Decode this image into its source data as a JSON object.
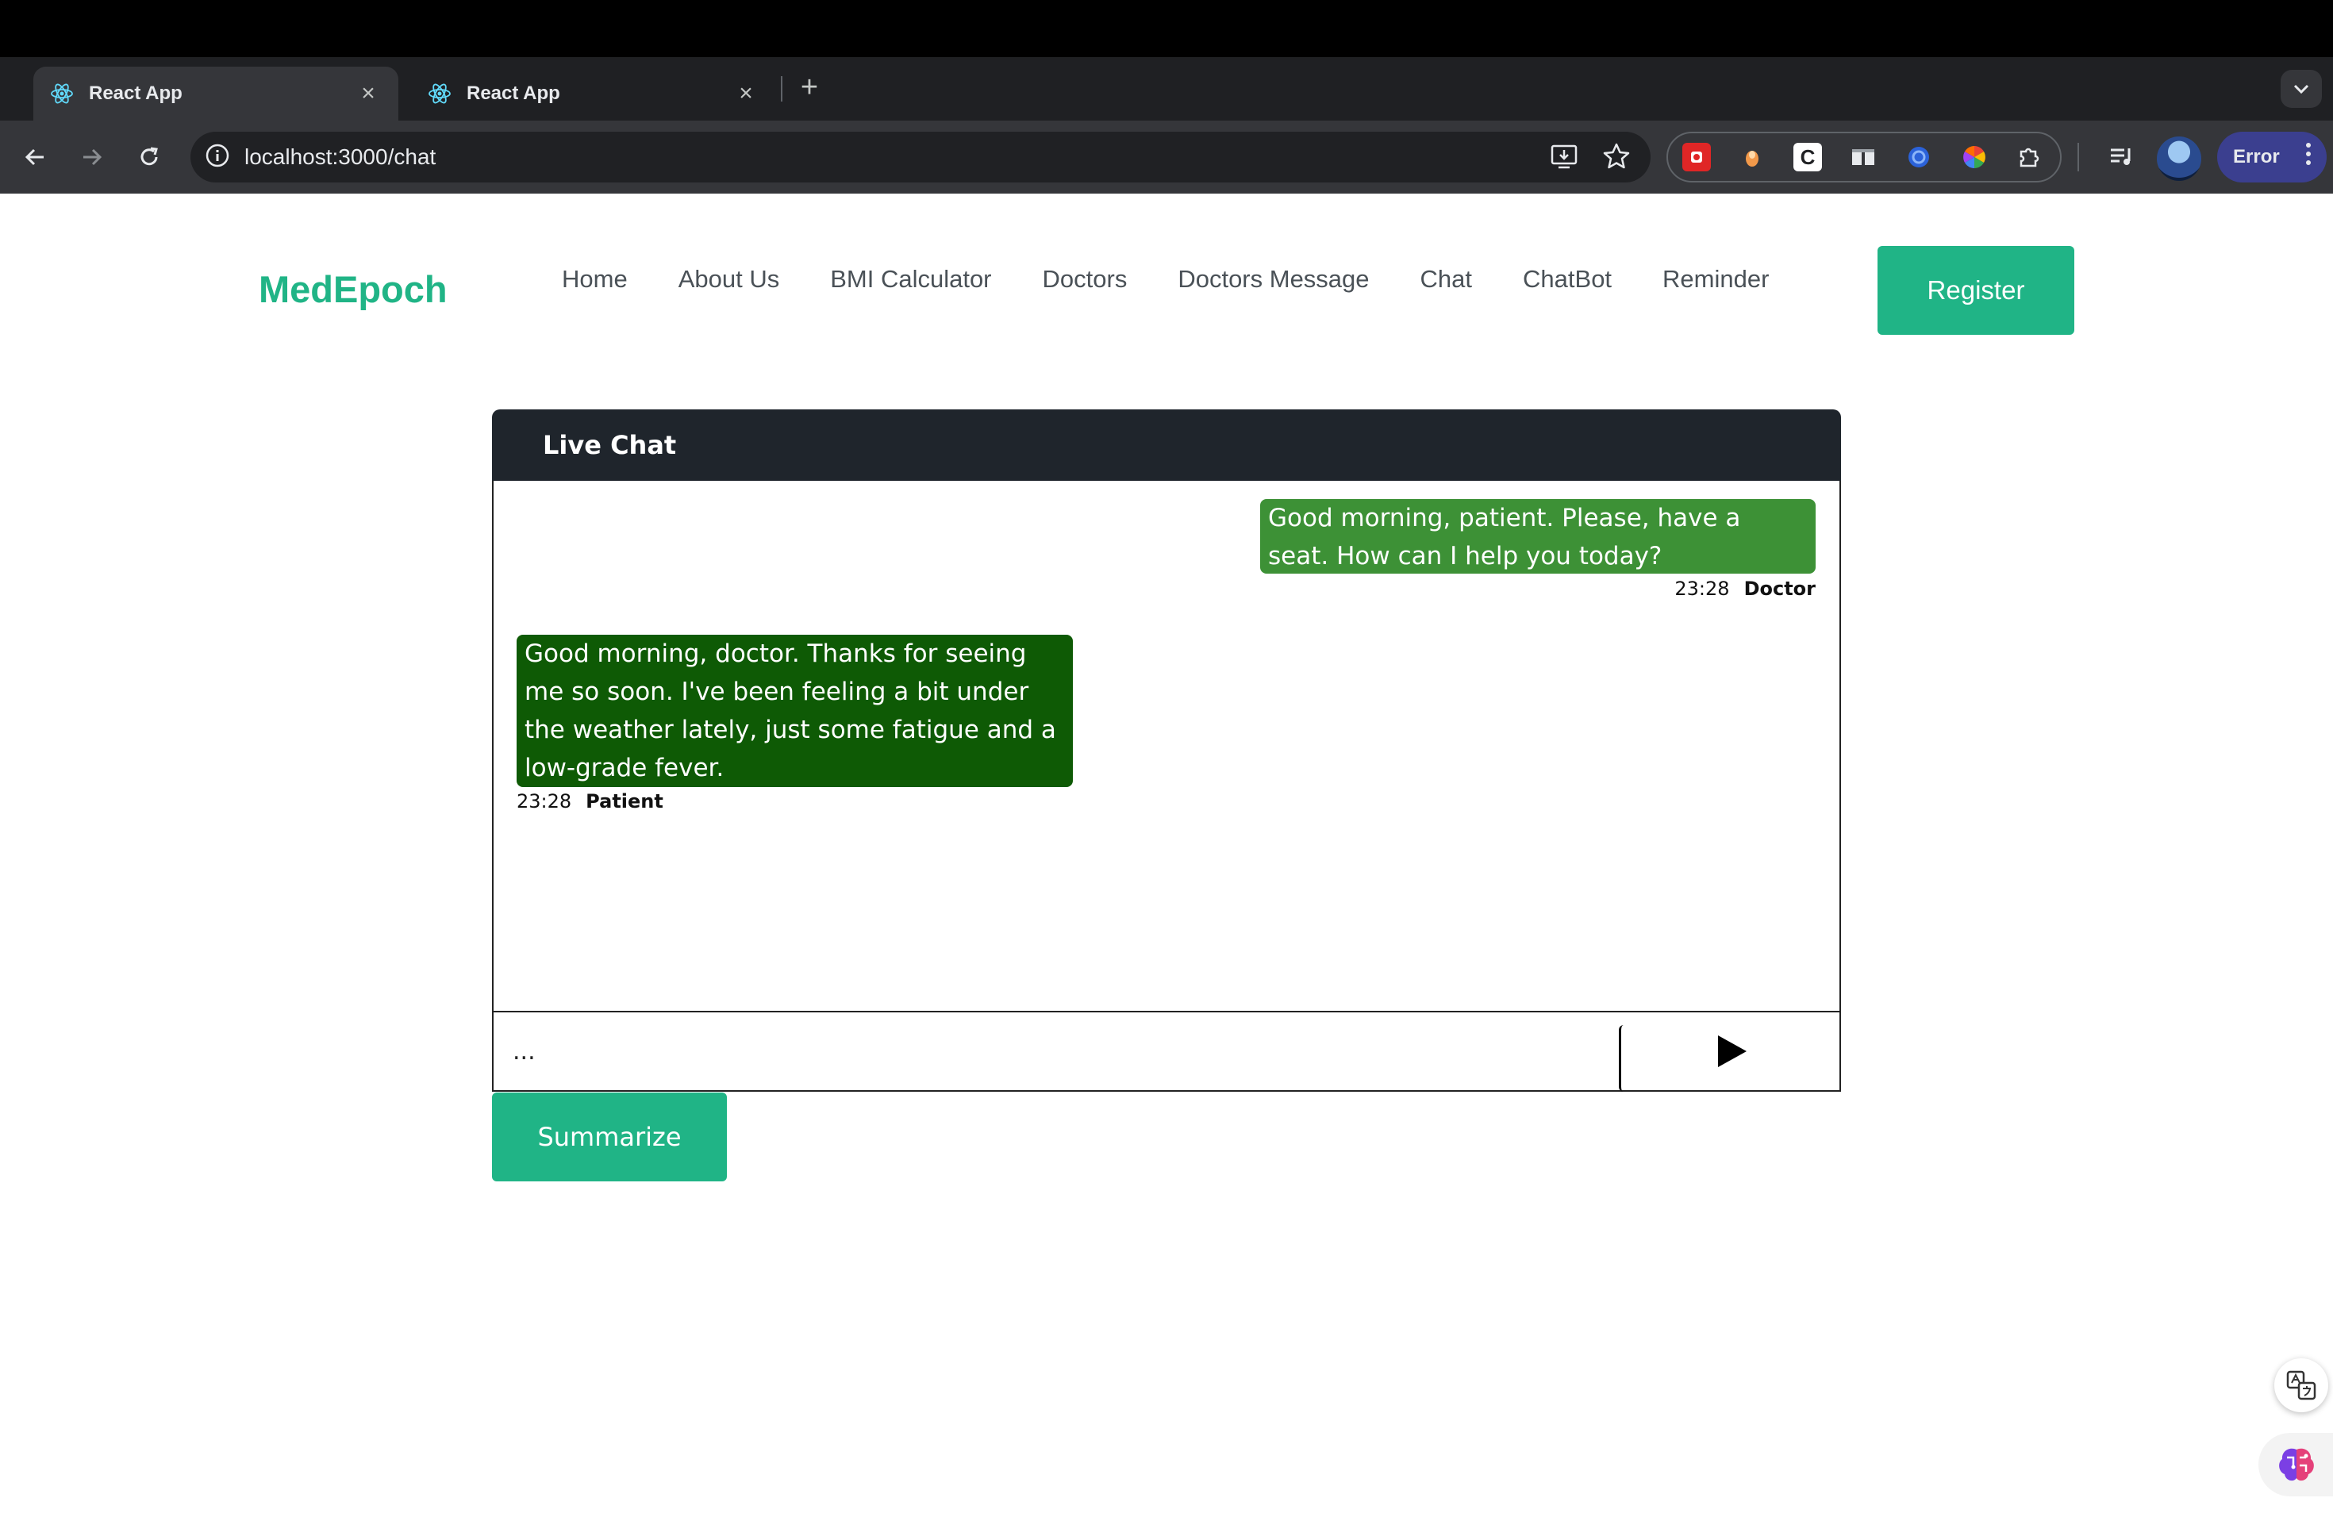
{
  "browser": {
    "tabs": [
      {
        "title": "React App",
        "active": true
      },
      {
        "title": "React App",
        "active": false
      }
    ],
    "url": "localhost:3000/chat",
    "profile_status": "Error",
    "colors": {
      "chrome_dark": "#1f2023",
      "toolbar": "#35363a",
      "omnibox": "#202124",
      "error_pill": "#3b3f8f"
    }
  },
  "site": {
    "brand": "MedEpoch",
    "nav": [
      "Home",
      "About Us",
      "BMI Calculator",
      "Doctors",
      "Doctors Message",
      "Chat",
      "ChatBot",
      "Reminder"
    ],
    "register_label": "Register",
    "accent_color": "#20b486"
  },
  "chat": {
    "title": "Live Chat",
    "messages": [
      {
        "sender": "Doctor",
        "time": "23:28",
        "text": "Good morning, patient. Please, have a seat. How can I help you today?",
        "color": "#3d9136"
      },
      {
        "sender": "Patient",
        "time": "23:28",
        "text": "Good morning, doctor. Thanks for seeing me so soon. I've been feeling a bit under the weather lately, just some fatigue and a low-grade fever.",
        "color": "#0e5a05"
      }
    ],
    "input_placeholder": "...",
    "send_icon": "play-triangle-icon",
    "summarize_label": "Summarize"
  },
  "widgets": {
    "translate_icon": "translate-icon",
    "assistant_icon": "brain-icon"
  }
}
